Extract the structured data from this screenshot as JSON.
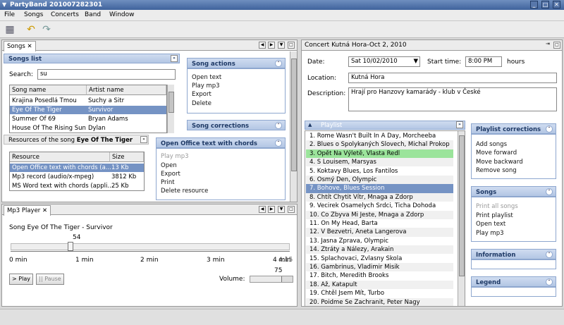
{
  "window": {
    "title": "PartyBand 201007282301",
    "min": "_",
    "max": "□",
    "close": "✕"
  },
  "menu": [
    "File",
    "Songs",
    "Concerts",
    "Band",
    "Window"
  ],
  "songs_panel": {
    "tab": "Songs",
    "list_header": "Songs list",
    "search_label": "Search:",
    "search_value": "su",
    "columns": [
      "Song name",
      "Artist name"
    ],
    "rows": [
      [
        "Krajina Posedlá Tmou",
        "Suchy a Sitr"
      ],
      [
        "Eye Of The Tiger",
        "Survivor"
      ],
      [
        "Summer Of 69",
        "Bryan Adams"
      ],
      [
        "House Of The Rising Sun",
        "Dylan"
      ]
    ],
    "selected": 1,
    "song_actions": {
      "title": "Song actions",
      "items": [
        "Open text",
        "Play mp3",
        "Export",
        "Delete"
      ]
    },
    "song_corrections": {
      "title": "Song corrections"
    },
    "resources_prefix": "Resources of the song ",
    "resources_song": "Eye Of The Tiger",
    "res_columns": [
      "Resource",
      "Size"
    ],
    "res_rows": [
      [
        "Open Office text with chords (a...",
        "13 Kb"
      ],
      [
        "Mp3 record (audio/x-mpeg)",
        "3812 Kb"
      ],
      [
        "MS Word text with chords (appli...",
        "25 Kb"
      ]
    ],
    "res_actions": {
      "title": "Open Office text with chords",
      "items": [
        "Play mp3",
        "Open",
        "Export",
        "Print",
        "Delete resource"
      ]
    }
  },
  "player": {
    "tab": "Mp3 Player",
    "song": "Song Eye Of The Tiger - Survivor",
    "position": "54",
    "position_fraction": 0.21,
    "ticks": [
      "0 min",
      "1 min",
      "2 min",
      "3 min",
      "4 min"
    ],
    "end_tick": "4:15",
    "volume_value": "75",
    "volume_fraction": 0.75,
    "volume_label": "Volume:",
    "play": "> Play",
    "pause": "|| Pause"
  },
  "concert": {
    "tab": "Concert Kutná Hora-Oct 2, 2010",
    "date_label": "Date:",
    "date_value": "Sat 10/02/2010",
    "time_label": "Start time:",
    "time_value": "8:00 PM",
    "hours": "hours",
    "location_label": "Location:",
    "location_value": "Kutná Hora",
    "description_label": "Description:",
    "description_value": "Hrají pro Hanzovy kamarády - klub v České",
    "playlist_title": "Playlist",
    "playlist": [
      "1.  Rome Wasn't Built In A Day, Morcheeba",
      "2.  Blues o Spolykaných Slovech, Michal Prokop",
      "3.  Opět Na Výletě, Vlasta Redl",
      "4.  S Louisem, Marsyas",
      "5.  Koktavy Blues, Los Fantilos",
      "6.  Osmý Den, Olympic",
      "7.  Bohove, Blues Session",
      "8.  Chtít Chytit Vítr, Mnaga a Zdorp",
      "9.  Vecirek Osamelych Srdci, Ticha Dohoda",
      "10. Co Zbyva Mi Jeste, Mnaga a Zdorp",
      "11. On My Head, Barta",
      "12. V Bezvetri, Aneta Langerova",
      "13. Jasna Zprava, Olympic",
      "14. Ztráty a Nálezy, Arakain",
      "15. Splachovaci, Zvlasny Skola",
      "16. Gambrinus, Vladimir Misik",
      "17. Bitch, Meredith Brooks",
      "18. Až, Katapult",
      "19. Chtěl Jsem Mít, Turbo",
      "20. Poidme Se Zachranit, Peter Nagy"
    ],
    "playlist_green": 2,
    "playlist_selected": 6,
    "corrections": {
      "title": "Playlist corrections",
      "items": [
        "Add songs",
        "Move forward",
        "Move backward",
        "Remove song"
      ]
    },
    "songs": {
      "title": "Songs",
      "items": [
        "Print all songs",
        "Print playlist",
        "Open text",
        "Play mp3"
      ]
    },
    "information": "Information",
    "legend": "Legend"
  },
  "colors": {
    "accent": "#7593c4",
    "green": "#9be49b",
    "header": "#b3c6e4"
  }
}
